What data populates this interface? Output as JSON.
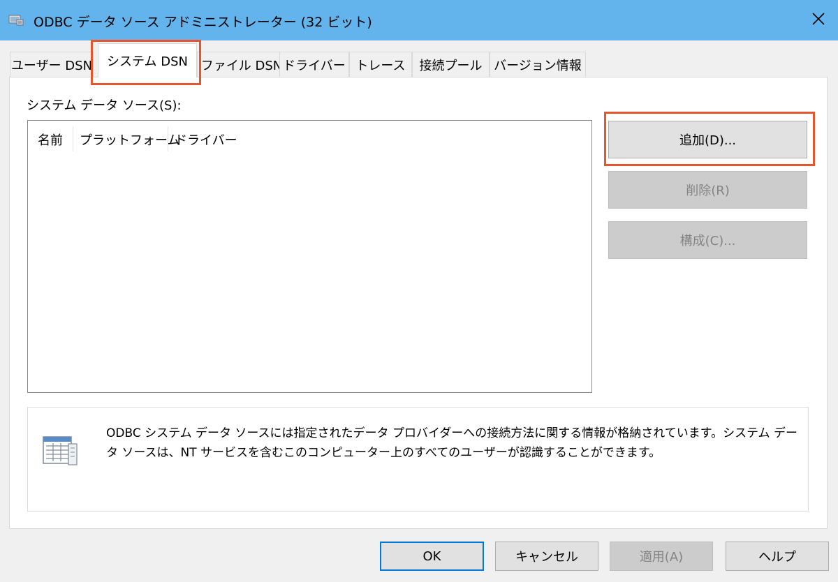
{
  "window": {
    "title": "ODBC データ ソース アドミニストレーター (32 ビット)",
    "close_glyph": "✕",
    "title_icon": "odbc-admin-icon",
    "titlebar_color": "#63b3ec"
  },
  "tabs": [
    {
      "label": "ユーザー DSN",
      "active": false
    },
    {
      "label": "システム DSN",
      "active": true
    },
    {
      "label": "ファイル DSN",
      "active": false
    },
    {
      "label": "ドライバー",
      "active": false
    },
    {
      "label": "トレース",
      "active": false
    },
    {
      "label": "接続プール",
      "active": false
    },
    {
      "label": "バージョン情報",
      "active": false
    }
  ],
  "main": {
    "list_label": "システム データ ソース(S):",
    "columns": [
      "名前",
      "プラットフォーム",
      "ドライバー"
    ],
    "rows": []
  },
  "actions": {
    "add": "追加(D)...",
    "remove": "削除(R)",
    "configure": "構成(C)..."
  },
  "info": {
    "icon": "data-source-icon",
    "text": "ODBC システム データ ソースには指定されたデータ プロバイダーへの接続方法に関する情報が格納されています。システム データ ソースは、NT サービスを含むこのコンピューター上のすべてのユーザーが認識することができます。"
  },
  "footer": {
    "ok": "OK",
    "cancel": "キャンセル",
    "apply": "適用(A)",
    "help": "ヘルプ"
  },
  "colors": {
    "highlight": "#e4572e",
    "default_button_border": "#0078d7"
  }
}
